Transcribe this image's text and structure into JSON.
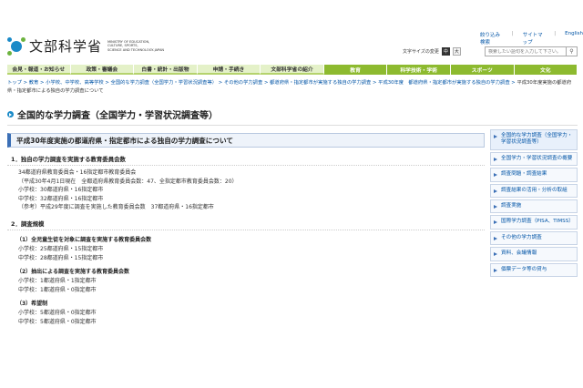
{
  "header": {
    "logo_text": "文部科学省",
    "logo_sub": [
      "MINISTRY OF EDUCATION,",
      "CULTURE, SPORTS,",
      "SCIENCE AND TECHNOLOGY-JAPAN"
    ],
    "util_links": [
      "絞り込み検索",
      "サイトマップ",
      "English"
    ],
    "textsize_label": "文字サイズの変更",
    "textsize_buttons": [
      "中",
      "大"
    ],
    "search_placeholder": "検索したい語句を入力して下さい。"
  },
  "nav": [
    {
      "label": "会見・報道・お知らせ",
      "style": "light"
    },
    {
      "label": "政策・審議会",
      "style": "light"
    },
    {
      "label": "白書・統計・出版物",
      "style": "light"
    },
    {
      "label": "申請・手続き",
      "style": "light"
    },
    {
      "label": "文部科学省の紹介",
      "style": "light"
    },
    {
      "label": "教育",
      "style": "dark"
    },
    {
      "label": "科学技術・学術",
      "style": "dark"
    },
    {
      "label": "スポーツ",
      "style": "dark"
    },
    {
      "label": "文化",
      "style": "dark"
    }
  ],
  "breadcrumb": {
    "items": [
      "トップ",
      "教育",
      "小学校、中学校、高等学校",
      "全国的な学力調査（全国学力・学習状況調査等）",
      "その他の学力調査",
      "都道府県・指定都市が実施する独自の学力調査",
      "平成30年度　都道府県・指定都市が実施する独自の学力調査"
    ],
    "current": "平成30年度実施の都道府県・指定都市による独自の学力調査について"
  },
  "page_title": "全国的な学力調査（全国学力・学習状況調査等）",
  "main": {
    "section_title": "平成30年度実施の都道府県・指定都市による独自の学力調査について",
    "s1": {
      "heading": "1．独自の学力調査を実施する教育委員会数",
      "lines": [
        "34都道府県教育委員会・16指定都市教育委員会",
        "（平成30年4月1日現在　全都道府県教育委員会数：47、全指定都市教育委員会数：20）",
        "小学校：30都道府県・16指定都市",
        "中学校：32都道府県・16指定都市",
        "（参考）平成29年度に調査を実施した教育委員会数　37都道府県・16指定都市"
      ]
    },
    "s2": {
      "heading": "2．調査規模",
      "sub1": {
        "title": "（1）全児童生徒を対象に調査を実施する教育委員会数",
        "lines": [
          "小学校：25都道府県・15指定都市",
          "中学校：28都道府県・15指定都市"
        ]
      },
      "sub2": {
        "title": "（2）抽出による調査を実施する教育委員会数",
        "lines": [
          "小学校：1都道府県・1指定都市",
          "中学校：1都道府県・0指定都市"
        ]
      },
      "sub3": {
        "title": "（3）希望制",
        "lines": [
          "小学校：5都道府県・0指定都市",
          "中学校：5都道府県・0指定都市"
        ]
      }
    }
  },
  "sidebar": [
    {
      "label": "全国的な学力調査（全国学力・学習状況調査等）",
      "active": true
    },
    {
      "label": "全国学力・学習状況調査の概要",
      "active": false
    },
    {
      "label": "調査問題・調査結果",
      "active": false
    },
    {
      "label": "調査結果の活用・分析の取組",
      "active": false
    },
    {
      "label": "調査実施",
      "active": false
    },
    {
      "label": "国際学力調査（PISA、TIMSS）",
      "active": false
    },
    {
      "label": "その他の学力調査",
      "active": false
    },
    {
      "label": "資料、会議情報",
      "active": false
    },
    {
      "label": "個票データ等の貸与",
      "active": false
    }
  ]
}
